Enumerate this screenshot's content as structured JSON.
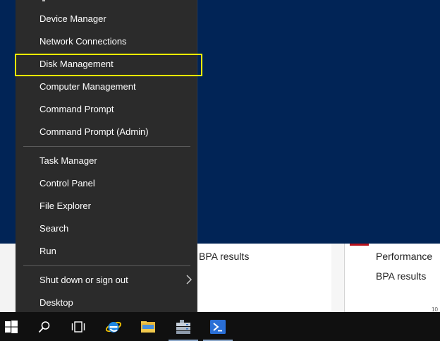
{
  "menu": {
    "items": [
      {
        "label": "Device Manager"
      },
      {
        "label": "Network Connections"
      },
      {
        "label": "Disk Management"
      },
      {
        "label": "Computer Management"
      },
      {
        "label": "Command Prompt"
      },
      {
        "label": "Command Prompt (Admin)"
      },
      {
        "label": "Task Manager"
      },
      {
        "label": "Control Panel"
      },
      {
        "label": "File Explorer"
      },
      {
        "label": "Search"
      },
      {
        "label": "Run"
      },
      {
        "label": "Shut down or sign out"
      },
      {
        "label": "Desktop"
      }
    ],
    "highlighted": "Disk Management",
    "highlight_color": "#ffff00"
  },
  "background": {
    "bpa_left": "BPA results",
    "performance": "Performance",
    "bpa_right": "BPA results",
    "corner_fragment": "10"
  },
  "taskbar": {
    "icons": [
      "windows-start-icon",
      "search-icon",
      "task-view-icon",
      "internet-explorer-icon",
      "file-explorer-icon",
      "server-manager-icon",
      "powershell-icon"
    ]
  },
  "colors": {
    "desktop": "#012456",
    "menu": "#2b2b2b",
    "taskbar": "#101010"
  }
}
